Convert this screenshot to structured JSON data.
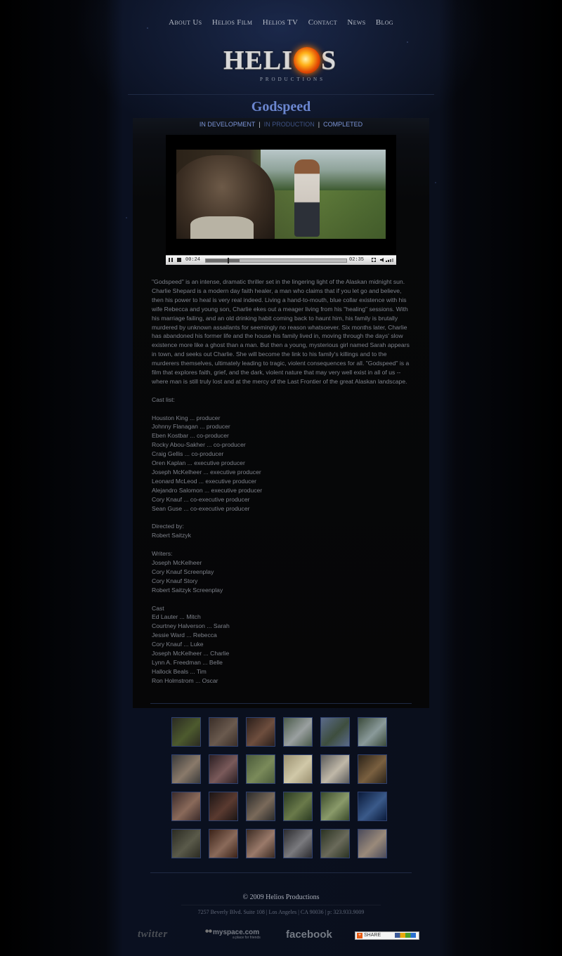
{
  "nav": {
    "items": [
      "About Us",
      "Helios Film",
      "Helios TV",
      "Contact",
      "News",
      "Blog"
    ]
  },
  "logo": {
    "word_left": "HELI",
    "word_right": "S",
    "subtitle": "PRODUCTIONS"
  },
  "title": "Godspeed",
  "subnav": {
    "items": [
      "IN DEVELOPMENT",
      "IN PRODUCTION",
      "COMPLETED"
    ],
    "active": "IN PRODUCTION",
    "separator": "|"
  },
  "player": {
    "current_time": "00:24",
    "duration": "02:35",
    "progress_fraction": 0.155,
    "buffered_fraction": 0.24
  },
  "description": "\"Godspeed\" is an intense, dramatic thriller set in the lingering light of the Alaskan midnight sun. Charlie Shepard is a modern day faith healer, a man who claims that if you let go and believe, then his power to heal is very real indeed. Living a hand-to-mouth, blue collar existence with his wife Rebecca and young son, Charlie ekes out a meager living from his \"healing\" sessions. With his marriage failing, and an old drinking habit coming back to haunt him, his family is brutally murdered by unknown assailants for seemingly no reason whatsoever. Six months later, Charlie has abandoned his former life and the house his family lived in, moving through the days' slow existence more like a ghost than a man. But then a young, mysterious girl named Sarah appears in town, and seeks out Charlie. She will become the link to his family's killings and to the murderers themselves, ultimately leading to tragic, violent consequences for all. \"Godspeed\" is a film that explores faith, grief, and the dark, violent nature that may very well exist in all of us -- where man is still truly lost and at the mercy of the Last Frontier of the great Alaskan landscape.",
  "credits": {
    "cast_list_heading": "Cast list:",
    "producers": [
      "Houston King ... producer",
      "Johnny Flanagan ... producer",
      "Eben Kostbar ... co-producer",
      "Rocky Abou-Sakher ... co-producer",
      "Craig Gellis ... co-producer",
      "Oren Kaplan ... executive producer",
      "Joseph McKelheer ... executive producer",
      "Leonard McLeod ... executive producer",
      "Alejandro Salomon ... executive producer",
      "Cory Knauf ... co-executive producer",
      "Sean Guse ... co-executive producer"
    ],
    "directed_heading": "Directed by:",
    "director": "Robert Saitzyk",
    "writers_heading": "Writers:",
    "writers": [
      "Joseph McKelheer",
      "Cory Knauf  Screenplay",
      "Cory Knauf  Story",
      "Robert Saitzyk  Screenplay"
    ],
    "cast_heading": "Cast",
    "cast": [
      "Ed Lauter ... Mitch",
      "Courtney Halverson ... Sarah",
      "Jessie Ward ... Rebecca",
      "Cory Knauf ... Luke",
      "Joseph McKelheer ... Charlie",
      "Lynn A. Freedman ... Belle",
      "Hallock Beals ... Tim",
      "Ron Holmstrom ... Oscar"
    ]
  },
  "gallery": {
    "thumbs": [
      {
        "c1": "#2a2a22",
        "c2": "#4d5a2e"
      },
      {
        "c1": "#3a2e28",
        "c2": "#6a5a4e"
      },
      {
        "c1": "#2a1e1a",
        "c2": "#6e4e3e"
      },
      {
        "c1": "#4a5a4a",
        "c2": "#9aa0a0"
      },
      {
        "c1": "#5a6a8a",
        "c2": "#3e4e3e"
      },
      {
        "c1": "#3a4a3a",
        "c2": "#8a9a9a"
      },
      {
        "c1": "#3a3a3a",
        "c2": "#8a7a6a"
      },
      {
        "c1": "#2a1e22",
        "c2": "#7a5a5a"
      },
      {
        "c1": "#4a5a3a",
        "c2": "#7a8a5a"
      },
      {
        "c1": "#9a9070",
        "c2": "#d0c8a8"
      },
      {
        "c1": "#5a5a5a",
        "c2": "#c0b8a8"
      },
      {
        "c1": "#2a2218",
        "c2": "#7a6040"
      },
      {
        "c1": "#3a2a2a",
        "c2": "#8a6a5a"
      },
      {
        "c1": "#1a1414",
        "c2": "#5a3a30"
      },
      {
        "c1": "#2a2a2a",
        "c2": "#7a6a5a"
      },
      {
        "c1": "#2a3a22",
        "c2": "#6a7a4a"
      },
      {
        "c1": "#3a4a2a",
        "c2": "#8a9a6a"
      },
      {
        "c1": "#0a1a3a",
        "c2": "#3a5a8a"
      },
      {
        "c1": "#2a2a22",
        "c2": "#5a5a4a"
      },
      {
        "c1": "#3a2218",
        "c2": "#8a6a5a"
      },
      {
        "c1": "#3a2a22",
        "c2": "#9a7a6a"
      },
      {
        "c1": "#2a2a2e",
        "c2": "#7a7a7e"
      },
      {
        "c1": "#2a3222",
        "c2": "#6a6a5a"
      },
      {
        "c1": "#4a4a5a",
        "c2": "#9a8a7a"
      }
    ]
  },
  "footer": {
    "copyright": "© 2009 Helios Productions",
    "address": "7257 Beverly Blvd. Suite 108 | Los Angeles | CA 90036 | p: 323.933.9009",
    "social": {
      "twitter": "twitter",
      "myspace": "myspace.com",
      "myspace_tagline": "a place for friends",
      "facebook": "facebook",
      "share": "SHARE"
    }
  }
}
